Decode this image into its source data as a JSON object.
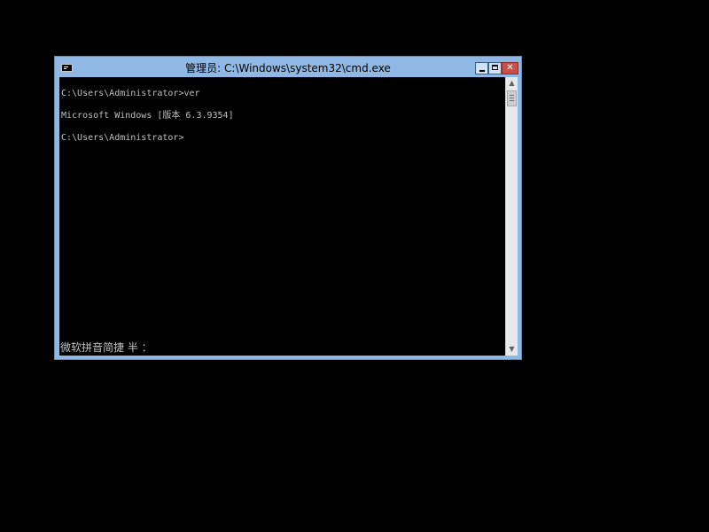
{
  "window": {
    "title": "管理员: C:\\Windows\\system32\\cmd.exe",
    "icon": "console-icon",
    "buttons": {
      "minimize": "minimize-icon",
      "maximize": "maximize-icon",
      "close": "close-icon"
    }
  },
  "console": {
    "lines": [
      "C:\\Users\\Administrator>ver",
      "Microsoft Windows [版本 6.3.9354]",
      "C:\\Users\\Administrator>"
    ],
    "ime_status": "微软拼音简捷 半 ："
  },
  "scrollbar": {
    "up_glyph": "▲",
    "down_glyph": "▼"
  },
  "colors": {
    "frame": "#8fb8e4",
    "console_bg": "#000000",
    "console_text": "#c0c0c0",
    "close_button": "#c7504a"
  }
}
